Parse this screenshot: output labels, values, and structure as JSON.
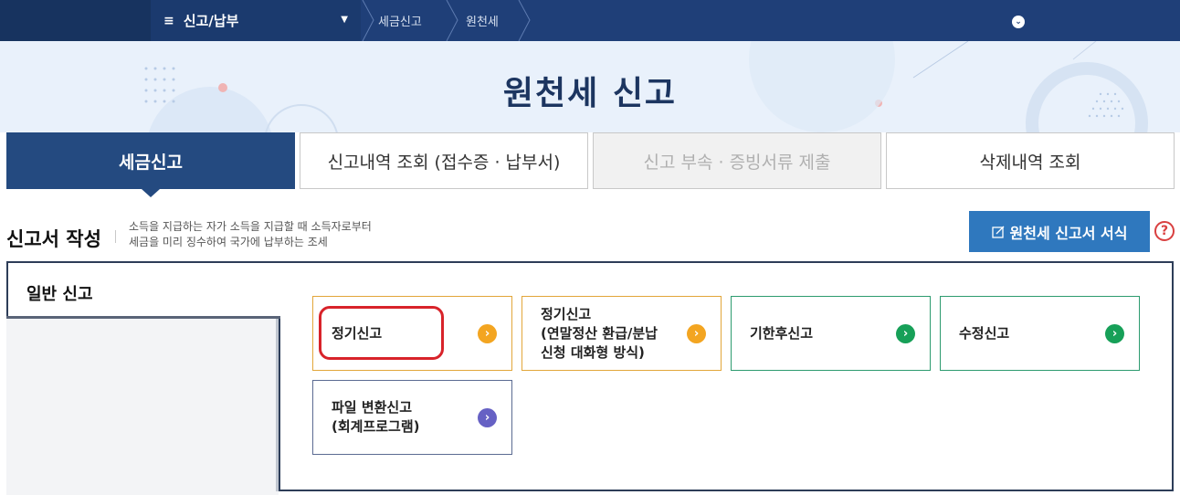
{
  "nav": {
    "menu_icon": "≡",
    "menu_label": "신고/납부",
    "breadcrumbs": [
      "세금신고",
      "원천세"
    ]
  },
  "hero": {
    "title": "원천세 신고"
  },
  "tabs": [
    {
      "label": "세금신고",
      "state": "active"
    },
    {
      "label": "신고내역 조회 (접수증 · 납부서)",
      "state": "normal"
    },
    {
      "label": "신고 부속 · 증빙서류 제출",
      "state": "disabled"
    },
    {
      "label": "삭제내역 조회",
      "state": "normal"
    }
  ],
  "section": {
    "title": "신고서 작성",
    "desc_line1": "소득을 지급하는 자가 소득을 지급할 때 소득자로부터",
    "desc_line2": "세금을 미리 징수하여 국가에 납부하는 조세",
    "form_button": "원천세 신고서 서식",
    "help": "?"
  },
  "panel": {
    "category": "일반 신고",
    "options": [
      {
        "label": "정기신고",
        "color": "#f3a521"
      },
      {
        "label": "정기신고\n(연말정산 환급/분납\n신청 대화형 방식)",
        "color": "#f3a521"
      },
      {
        "label": "기한후신고",
        "color": "#17a058"
      },
      {
        "label": "수정신고",
        "color": "#17a058"
      },
      {
        "label": "파일 변환신고\n(회계프로그램)",
        "color": "#6661c4"
      }
    ]
  },
  "colors": {
    "brand": "#1f3f78",
    "accent": "#2f78be",
    "highlight": "#d8232a"
  }
}
